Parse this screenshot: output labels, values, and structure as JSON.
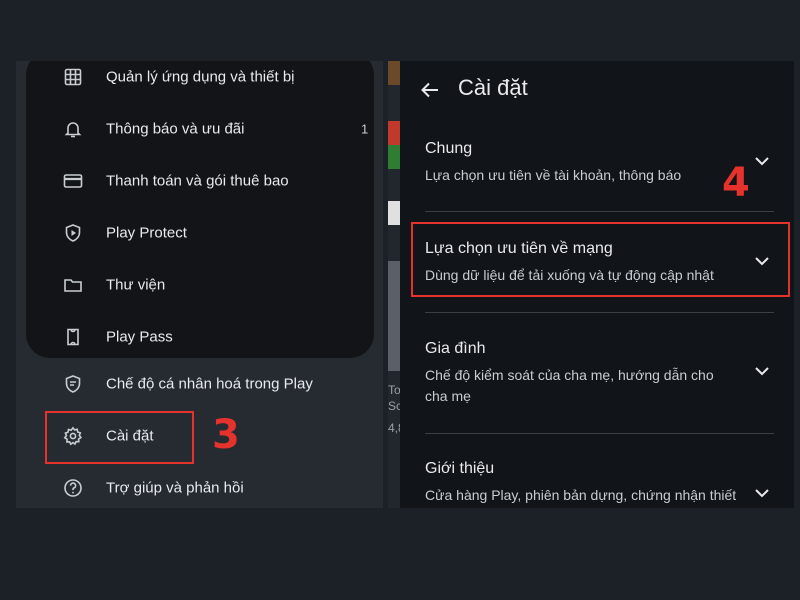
{
  "left_menu": {
    "items": [
      {
        "label": "Quản lý ứng dụng và thiết bị",
        "icon": "grid-icon"
      },
      {
        "label": "Thông báo và ưu đãi",
        "icon": "bell-icon",
        "count": "1"
      },
      {
        "label": "Thanh toán và gói thuê bao",
        "icon": "credit-card-icon"
      },
      {
        "label": "Play Protect",
        "icon": "shield-play-icon"
      },
      {
        "label": "Thư viện",
        "icon": "folder-icon"
      },
      {
        "label": "Play Pass",
        "icon": "ticket-icon"
      }
    ],
    "extra_items": [
      {
        "label": "Chế độ cá nhân hoá trong Play",
        "icon": "personalize-icon"
      },
      {
        "label": "Cài đặt",
        "icon": "gear-icon"
      },
      {
        "label": "Trợ giúp và phản hồi",
        "icon": "help-icon"
      }
    ]
  },
  "strip": {
    "line1": "To",
    "line2": "Sc",
    "line3": "4,8"
  },
  "settings": {
    "title": "Cài đặt",
    "back_icon": "back-arrow-icon",
    "sections": [
      {
        "title": "Chung",
        "subtitle": "Lựa chọn ưu tiên về tài khoản, thông báo"
      },
      {
        "title": "Lựa chọn ưu tiên về mạng",
        "subtitle": "Dùng dữ liệu để tải xuống và tự động cập nhật"
      },
      {
        "title": "Gia đình",
        "subtitle": "Chế độ kiểm soát của cha mẹ, hướng dẫn cho cha mẹ"
      },
      {
        "title": "Giới thiệu",
        "subtitle": "Cửa hàng Play, phiên bản dựng, chứng nhận thiết"
      }
    ]
  },
  "annotations": {
    "step3": "3",
    "step4": "4",
    "color": "#e5322d"
  },
  "colors": {
    "background": "#1c2127",
    "left_panel": "#252b31",
    "menu_card": "#121417",
    "right_panel": "#111418",
    "text": "#e8eaed"
  }
}
